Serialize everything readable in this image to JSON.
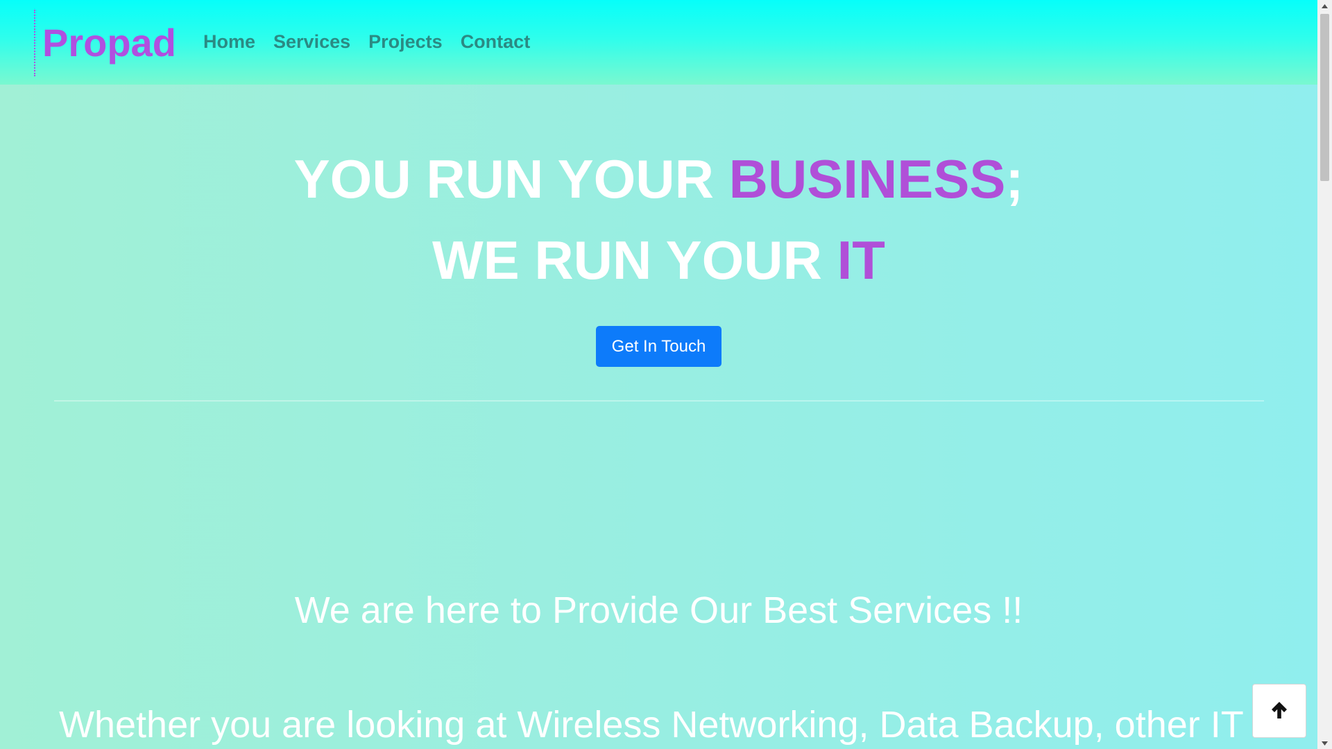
{
  "brand": {
    "name": "Propad",
    "color": "#b04fe0"
  },
  "nav": {
    "items": [
      {
        "label": "Home"
      },
      {
        "label": "Services"
      },
      {
        "label": "Projects"
      },
      {
        "label": "Contact"
      }
    ],
    "link_color": "#2b8a83"
  },
  "hero": {
    "line1_prefix": "YOU RUN YOUR ",
    "line1_accent": "BUSINESS",
    "line1_suffix": ";",
    "line2_prefix": "WE RUN YOUR ",
    "line2_accent": "IT",
    "accent_color": "#b04fd8",
    "cta_label": "Get In Touch",
    "cta_color": "#0d7bfa"
  },
  "services": {
    "tagline": "We are here to Provide Our Best Services !!",
    "lead_text": "Whether you are looking at Wireless Networking, Data Backup, other IT"
  },
  "back_to_top": {
    "icon": "arrow-up-icon"
  },
  "colors": {
    "header_top": "#06fffa",
    "header_bottom": "#7af8d0",
    "page_bg": "#98eee2"
  }
}
